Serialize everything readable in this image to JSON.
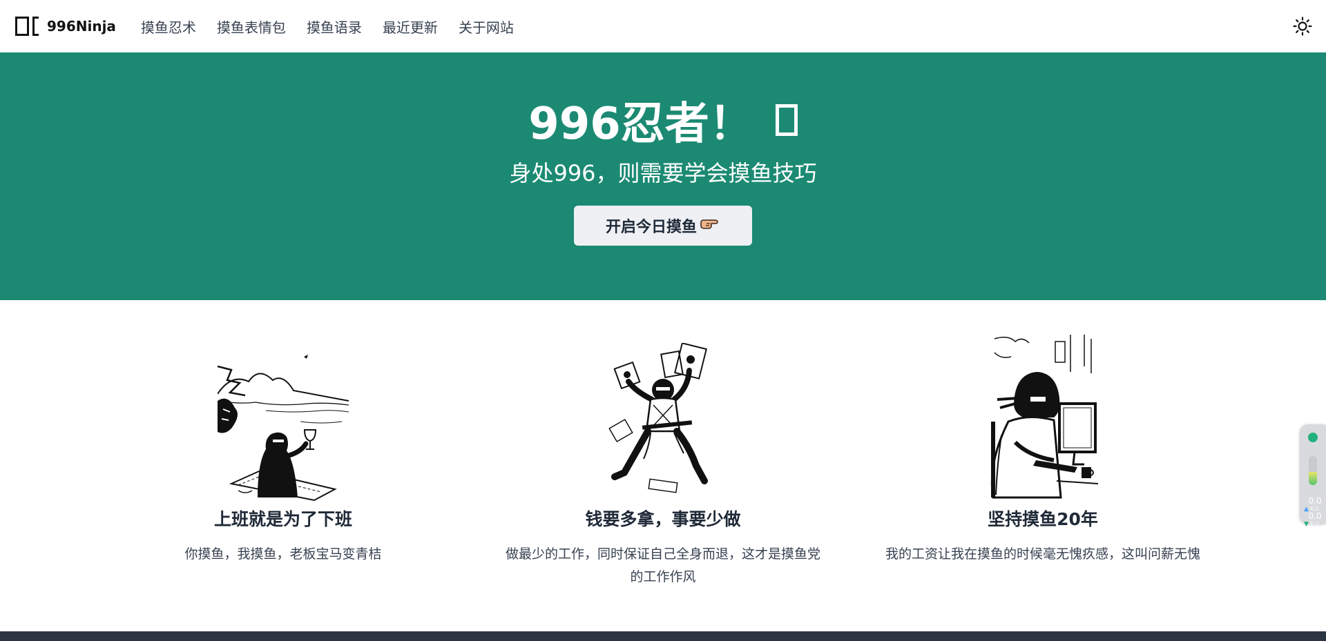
{
  "navbar": {
    "brand": "996Ninja",
    "links": [
      "摸鱼忍术",
      "摸鱼表情包",
      "摸鱼语录",
      "最近更新",
      "关于网站"
    ]
  },
  "hero": {
    "title": "996忍者！",
    "subtitle": "身处996，则需要学会摸鱼技巧",
    "button_label": "开启今日摸鱼"
  },
  "features": [
    {
      "title": "上班就是为了下班",
      "description": "你摸鱼，我摸鱼，老板宝马变青桔",
      "image": "ninja-beach-picnic-illustration"
    },
    {
      "title": "钱要多拿，事要少做",
      "description": "做最少的工作，同时保证自己全身而退，这才是摸鱼党的工作作风",
      "image": "ninja-holding-money-illustration"
    },
    {
      "title": "坚持摸鱼20年",
      "description": "我的工资让我在摸鱼的时候毫无愧疚感，这叫问薪无愧",
      "image": "ninja-at-computer-illustration"
    }
  ],
  "speed_widget": {
    "upload_value": "0.0",
    "upload_unit": "K/s",
    "download_value": "0.0",
    "download_unit": "K/s",
    "level": 0.45
  },
  "colors": {
    "hero_bg": "#1c8a73",
    "footer_bg": "#2d3442",
    "button_bg": "#eef0f4"
  }
}
